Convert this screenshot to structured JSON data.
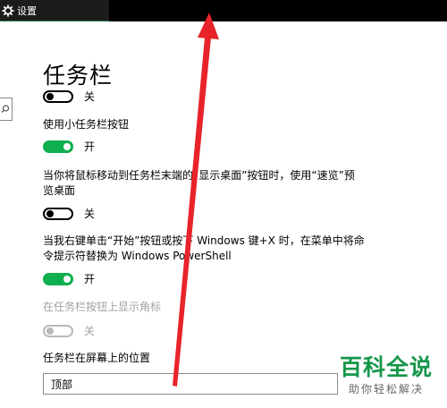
{
  "window": {
    "title": "设置"
  },
  "page": {
    "title": "任务栏"
  },
  "settings": [
    {
      "label": "",
      "state": "关",
      "on": false,
      "disabled": false
    },
    {
      "label": "使用小任务栏按钮",
      "state": "开",
      "on": true,
      "disabled": false
    },
    {
      "label": "当你将鼠标移动到任务栏末端的“显示桌面”按钮时，使用“速览”预览桌面",
      "state": "关",
      "on": false,
      "disabled": false
    },
    {
      "label": "当我右键单击“开始”按钮或按下 Windows 键+X 时，在菜单中将命令提示符替换为 Windows PowerShell",
      "state": "开",
      "on": true,
      "disabled": false
    },
    {
      "label": "在任务栏按钮上显示角标",
      "state": "关",
      "on": false,
      "disabled": true
    }
  ],
  "position": {
    "label": "任务栏在屏幕上的位置",
    "value": "顶部"
  },
  "watermark": {
    "main": "百科全说",
    "sub": "助你轻松解决"
  },
  "colors": {
    "accent": "#0fae4e",
    "annotation_arrow": "#e8232a",
    "watermark": "#15964a"
  }
}
